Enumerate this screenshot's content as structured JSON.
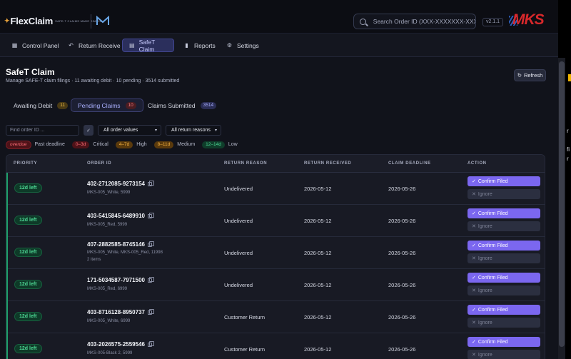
{
  "app": {
    "logo_text": "FlexClaim",
    "logo_tagline": "SAFE-T CLAIMS MADE SIMPLE",
    "version": "v2.1.1",
    "brand": "MKS",
    "search_placeholder": "Search Order ID (XXX-XXXXXXX-XXXXXXX)"
  },
  "nav": {
    "items": [
      {
        "label": "Control Panel",
        "icon": "grid-icon"
      },
      {
        "label": "Return Receive",
        "icon": "return-arrow-icon"
      },
      {
        "label": "SafeT Claim",
        "icon": "document-icon"
      },
      {
        "label": "Reports",
        "icon": "bar-chart-icon"
      },
      {
        "label": "Settings",
        "icon": "gear-icon"
      }
    ],
    "active": "SafeT Claim"
  },
  "page": {
    "title": "SafeT Claim",
    "subtitle": "Manage SAFE-T claim filings · 11 awaiting debit · 10 pending · 3514 submitted",
    "refresh_label": "Refresh"
  },
  "tabs": [
    {
      "label": "Awaiting Debit",
      "count": "11"
    },
    {
      "label": "Pending Claims",
      "count": "10"
    },
    {
      "label": "Claims Submitted",
      "count": "3514"
    }
  ],
  "filters": {
    "order_placeholder": "Find order ID ...",
    "values_select": "All order values",
    "reasons_select": "All return reasons"
  },
  "legend": [
    {
      "pill": "overdue",
      "text": "Past deadline"
    },
    {
      "pill": "0–3d",
      "text": "Critical"
    },
    {
      "pill": "4–7d",
      "text": "High"
    },
    {
      "pill": "8–11d",
      "text": "Medium"
    },
    {
      "pill": "12–14d",
      "text": "Low"
    }
  ],
  "table": {
    "headers": [
      "PRIORITY",
      "ORDER ID",
      "RETURN REASON",
      "RETURN RECEIVED",
      "CLAIM DEADLINE",
      "ACTION"
    ],
    "confirm_label": "Confirm Filed",
    "ignore_label": "Ignore",
    "rows": [
      {
        "priority": "12d left",
        "order_id": "402-2712085-9273154",
        "sku": "MKS-005_White, 5999",
        "items": "",
        "reason": "Undelivered",
        "received": "2026-05-12",
        "deadline": "2026-05-26"
      },
      {
        "priority": "12d left",
        "order_id": "403-5415845-6489910",
        "sku": "MKS-005_Red, 5999",
        "items": "",
        "reason": "Undelivered",
        "received": "2026-05-12",
        "deadline": "2026-05-26"
      },
      {
        "priority": "12d left",
        "order_id": "407-2882585-8745146",
        "sku": "MKS-005_White, MKS-005_Red, 11998",
        "items": "2 items",
        "reason": "Undelivered",
        "received": "2026-05-12",
        "deadline": "2026-05-26"
      },
      {
        "priority": "12d left",
        "order_id": "171-5034587-7971500",
        "sku": "MKS-005_Red, 6999",
        "items": "",
        "reason": "Undelivered",
        "received": "2026-05-12",
        "deadline": "2026-05-26"
      },
      {
        "priority": "12d left",
        "order_id": "403-8716128-8950737",
        "sku": "MKS-005_White, 6999",
        "items": "",
        "reason": "Customer Return",
        "received": "2026-05-12",
        "deadline": "2026-05-26"
      },
      {
        "priority": "12d left",
        "order_id": "403-2026575-2559546",
        "sku": "MKS-005-Black 2, 5999",
        "items": "",
        "reason": "Customer Return",
        "received": "2026-05-12",
        "deadline": "2026-05-26"
      }
    ]
  },
  "edge": {
    "text1": "r",
    "text2": "fi",
    "text3": "r"
  }
}
